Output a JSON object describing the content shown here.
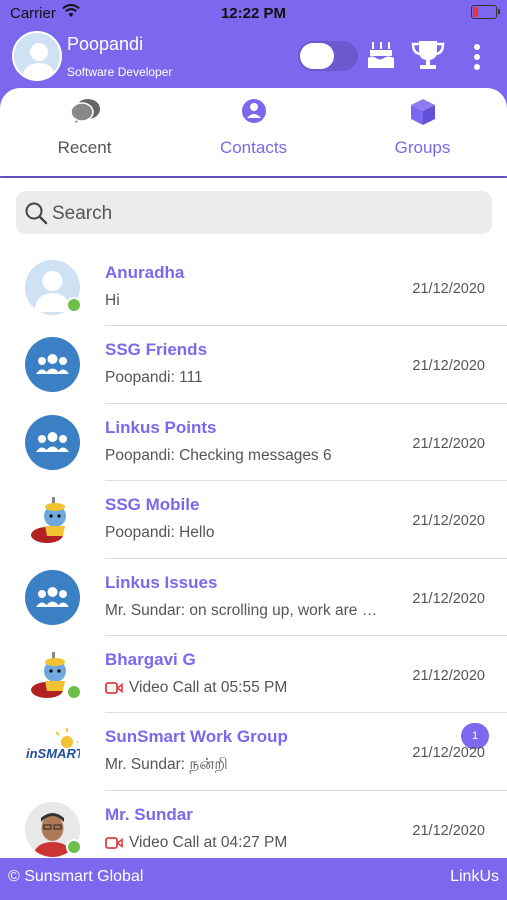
{
  "status_bar": {
    "carrier": "Carrier",
    "time": "12:22 PM"
  },
  "header": {
    "user_name": "Poopandi",
    "user_role": "Software Developer",
    "icons": [
      "toggle-switch",
      "birthday-cake-icon",
      "trophy-icon",
      "more-vertical-icon"
    ]
  },
  "tabs": [
    {
      "label": "Recent",
      "icon": "chat-bubbles-icon",
      "active": false
    },
    {
      "label": "Contacts",
      "icon": "contact-user-icon",
      "active": true
    },
    {
      "label": "Groups",
      "icon": "cube-icon",
      "active": true
    }
  ],
  "search": {
    "placeholder": "Search"
  },
  "chats": [
    {
      "name": "Anuradha",
      "message": "Hi",
      "date": "21/12/2020",
      "avatar": "person-placeholder",
      "online": true
    },
    {
      "name": "SSG Friends",
      "message": "Poopandi: 111",
      "date": "21/12/2020",
      "avatar": "group-icon",
      "online": false
    },
    {
      "name": "Linkus Points",
      "message": "Poopandi: Checking messages 6",
      "date": "21/12/2020",
      "avatar": "group-icon",
      "online": false
    },
    {
      "name": "SSG Mobile",
      "message": "Poopandi: Hello",
      "date": "21/12/2020",
      "avatar": "krishna-image",
      "online": false
    },
    {
      "name": "Linkus Issues",
      "message": "Mr. Sundar: on scrolling up, work are …",
      "date": "21/12/2020",
      "avatar": "group-icon",
      "online": false
    },
    {
      "name": "Bhargavi G",
      "message": "Video Call at 05:55 PM",
      "date": "21/12/2020",
      "avatar": "krishna-image",
      "online": true,
      "video_call": true
    },
    {
      "name": "SunSmart Work Group",
      "message": "Mr. Sundar: நன்றி",
      "date": "21/12/2020",
      "avatar": "sunsmart-logo",
      "online": false,
      "unread": "1"
    },
    {
      "name": "Mr. Sundar",
      "message": "Video Call at 04:27 PM",
      "date": "21/12/2020",
      "avatar": "person-photo",
      "online": true,
      "video_call": true
    }
  ],
  "footer": {
    "left": "© Sunsmart Global",
    "right": "LinkUs"
  },
  "colors": {
    "accent": "#7b68ee",
    "online": "#6cc04a",
    "group_avatar": "#3b7fc4",
    "video_call": "#e04040"
  }
}
